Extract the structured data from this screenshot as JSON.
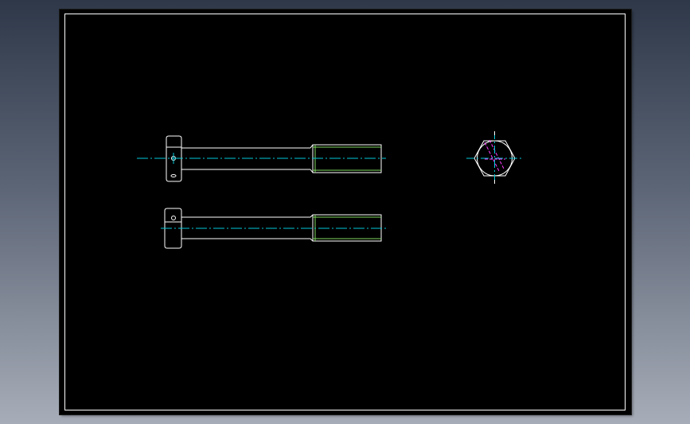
{
  "app": {
    "background_top": "#2e3849",
    "background_bottom": "#a7adb8"
  },
  "drawing": {
    "paper_color": "#000000",
    "border_color": "#ffffff",
    "colors": {
      "outline": "#ffffff",
      "centerline": "#00c8d8",
      "thread": "#7fd860",
      "hidden": "#ff3cff"
    },
    "views": [
      {
        "name": "bolt-front-view",
        "type": "elevation"
      },
      {
        "name": "bolt-top-view",
        "type": "plan"
      },
      {
        "name": "bolt-end-view",
        "type": "hex-end"
      }
    ]
  }
}
